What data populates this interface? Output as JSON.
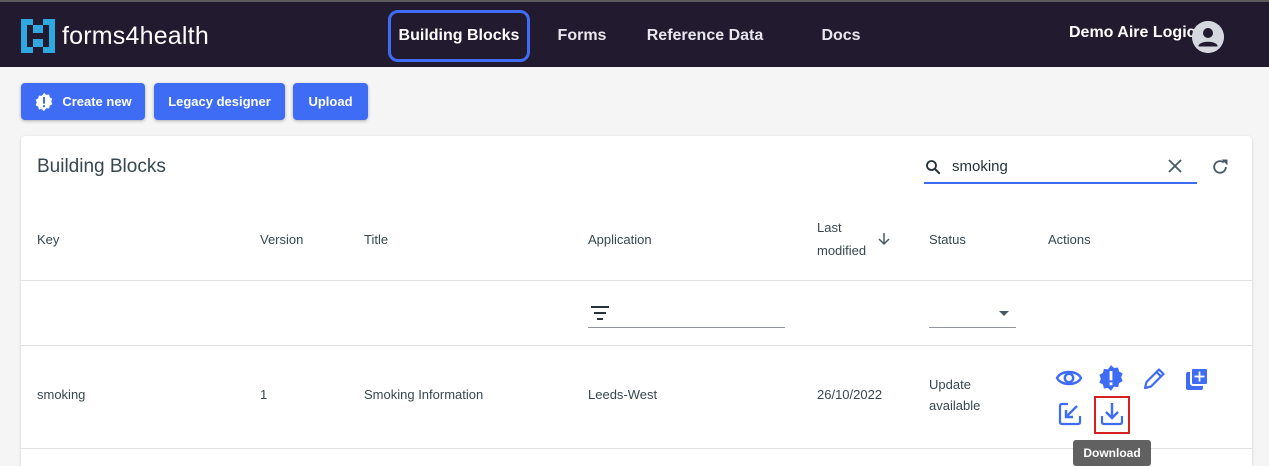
{
  "app": {
    "name": "forms4health",
    "user_name": "Demo Aire Logic"
  },
  "nav": [
    {
      "label": "Building Blocks",
      "active": true
    },
    {
      "label": "Forms",
      "active": false
    },
    {
      "label": "Reference Data",
      "active": false
    },
    {
      "label": "Docs",
      "active": false
    }
  ],
  "toolbar": {
    "create_label": "Create new",
    "legacy_label": "Legacy designer",
    "upload_label": "Upload"
  },
  "card": {
    "title": "Building Blocks",
    "search_value": "smoking"
  },
  "table": {
    "headers": {
      "key": "Key",
      "version": "Version",
      "title": "Title",
      "application": "Application",
      "last_modified_1": "Last",
      "last_modified_2": "modified",
      "status": "Status",
      "actions": "Actions"
    },
    "rows": [
      {
        "key": "smoking",
        "version": "1",
        "title": "Smoking Information",
        "application": "Leeds-West",
        "last_modified": "26/10/2022",
        "status_1": "Update",
        "status_2": "available"
      }
    ]
  },
  "tooltip": "Download",
  "colors": {
    "header_bg": "#221a2e",
    "accent": "#3f6cf5",
    "logo": "#2ea8e0",
    "highlight": "#d61f1f"
  }
}
